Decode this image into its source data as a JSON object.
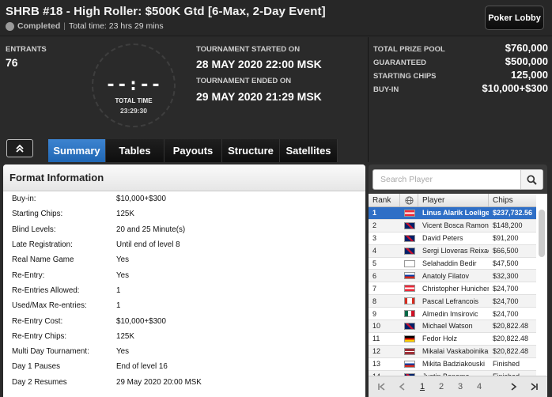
{
  "header": {
    "title": "SHRB #18 - High Roller: $500K Gtd [6-Max, 2-Day Event]",
    "status": "Completed",
    "total_time_text": "Total time: 23 hrs 29 mins",
    "lobby_button": "Poker Lobby"
  },
  "info": {
    "entrants_label": "ENTRANTS",
    "entrants_value": "76",
    "clock_digits": "--:--",
    "clock_label": "TOTAL TIME",
    "clock_time": "23:29:30",
    "started_label": "TOURNAMENT STARTED ON",
    "started_value": "28 MAY 2020  22:00 MSK",
    "ended_label": "TOURNAMENT ENDED ON",
    "ended_value": "29 MAY 2020  21:29 MSK"
  },
  "prize": [
    {
      "label": "TOTAL PRIZE POOL",
      "value": "$760,000"
    },
    {
      "label": "GUARANTEED",
      "value": "$500,000"
    },
    {
      "label": "STARTING CHIPS",
      "value": "125,000"
    },
    {
      "label": "BUY-IN",
      "value": "$10,000+$300"
    }
  ],
  "tabs": [
    "Summary",
    "Tables",
    "Payouts",
    "Structure",
    "Satellites"
  ],
  "active_tab": "Summary",
  "format": {
    "title": "Format Information",
    "rows": [
      {
        "k": "Buy-in:",
        "v": "$10,000+$300"
      },
      {
        "k": "Starting Chips:",
        "v": "125K"
      },
      {
        "k": "Blind Levels:",
        "v": "20 and 25 Minute(s)"
      },
      {
        "k": "Late Registration:",
        "v": "Until end of level 8"
      },
      {
        "k": "Real Name Game",
        "v": "Yes"
      },
      {
        "k": "Re-Entry:",
        "v": "Yes"
      },
      {
        "k": "Re-Entries Allowed:",
        "v": "1"
      },
      {
        "k": "Used/Max Re-entries:",
        "v": "1"
      },
      {
        "k": "Re-Entry Cost:",
        "v": "$10,000+$300"
      },
      {
        "k": "Re-Entry Chips:",
        "v": "125K"
      },
      {
        "k": "Multi Day Tournament:",
        "v": "Yes"
      },
      {
        "k": "Day 1 Pauses",
        "v": "End of level 16"
      },
      {
        "k": "Day 2 Resumes",
        "v": "29 May 2020  20:00 MSK"
      }
    ]
  },
  "players": {
    "search_placeholder": "Search Player",
    "columns": {
      "rank": "Rank",
      "player": "Player",
      "chips": "Chips"
    },
    "rows": [
      {
        "rank": "1",
        "flag": "at",
        "name": "Linus Alarik Loeliger",
        "chips": "$237,732.56",
        "selected": true
      },
      {
        "rank": "2",
        "flag": "gb",
        "name": "Vicent Bosca Ramon",
        "chips": "$148,200"
      },
      {
        "rank": "3",
        "flag": "gb",
        "name": "David Peters",
        "chips": "$91,200"
      },
      {
        "rank": "4",
        "flag": "gb",
        "name": "Sergi Lloveras Reixach",
        "chips": "$66,500"
      },
      {
        "rank": "5",
        "flag": "cy",
        "name": "Selahaddin Bedir",
        "chips": "$47,500"
      },
      {
        "rank": "6",
        "flag": "ru",
        "name": "Anatoly Filatov",
        "chips": "$32,300"
      },
      {
        "rank": "7",
        "flag": "at",
        "name": "Christopher Hunichen",
        "chips": "$24,700"
      },
      {
        "rank": "8",
        "flag": "ca",
        "name": "Pascal Lefrancois",
        "chips": "$24,700"
      },
      {
        "rank": "9",
        "flag": "mx",
        "name": "Almedin Imsirovic",
        "chips": "$24,700"
      },
      {
        "rank": "10",
        "flag": "gb",
        "name": "Michael Watson",
        "chips": "$20,822.48"
      },
      {
        "rank": "11",
        "flag": "de",
        "name": "Fedor Holz",
        "chips": "$20,822.48"
      },
      {
        "rank": "12",
        "flag": "lv",
        "name": "Mikalai Vaskaboinikau",
        "chips": "$20,822.48"
      },
      {
        "rank": "13",
        "flag": "ru",
        "name": "Mikita Badziakouski",
        "chips": "Finished"
      },
      {
        "rank": "14",
        "flag": "gb",
        "name": "Justin Bonomo",
        "chips": "Finished"
      }
    ],
    "pages": [
      "1",
      "2",
      "3",
      "4"
    ],
    "active_page": "1"
  },
  "colors": {
    "accent": "#2f6fc6",
    "header_bg": "#272727",
    "panel_bg": "#2a2a2a"
  },
  "icons": [
    "chevron-double-up-icon",
    "search-icon",
    "globe-icon",
    "first-page-icon",
    "prev-page-icon",
    "next-page-icon",
    "last-page-icon"
  ]
}
